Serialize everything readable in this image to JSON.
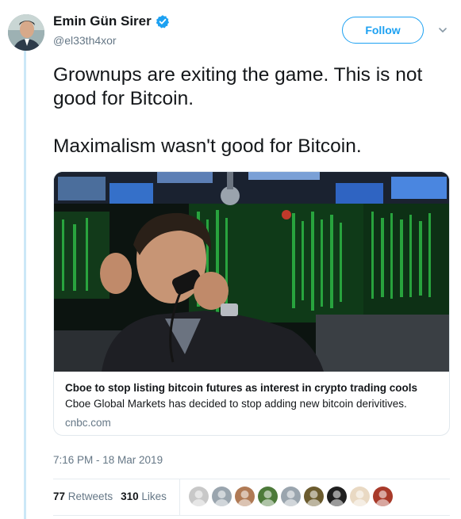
{
  "author": {
    "display_name": "Emin Gün Sirer",
    "handle": "@el33th4xor",
    "verified": true,
    "avatar_icon": "person-avatar"
  },
  "follow_label": "Follow",
  "menu_icon": "chevron-down-icon",
  "tweet": {
    "paragraphs": [
      "Grownups are exiting the game. This is not good for Bitcoin.",
      "Maximalism wasn't good for Bitcoin."
    ]
  },
  "card": {
    "image_icon": "trader-on-phone-photo",
    "title": "Cboe to stop listing bitcoin futures as interest in crypto trading cools",
    "description": "Cboe Global Markets has decided to stop adding new bitcoin derivitives.",
    "domain": "cnbc.com"
  },
  "timestamp": "7:16 PM - 18 Mar 2019",
  "stats": {
    "retweets_count": "77",
    "retweets_label": "Retweets",
    "likes_count": "310",
    "likes_label": "Likes"
  },
  "likers": [
    {
      "icon": "liker-avatar-1",
      "color": "#c8c8c8"
    },
    {
      "icon": "liker-avatar-default",
      "color": "#9aa5ae"
    },
    {
      "icon": "liker-avatar-3",
      "color": "#b07a55"
    },
    {
      "icon": "liker-avatar-4",
      "color": "#4d7a3a"
    },
    {
      "icon": "liker-avatar-default",
      "color": "#9aa5ae"
    },
    {
      "icon": "liker-avatar-6",
      "color": "#6b5b2e"
    },
    {
      "icon": "liker-avatar-hodl",
      "color": "#1f1f1f"
    },
    {
      "icon": "liker-avatar-8",
      "color": "#e9d9c3"
    },
    {
      "icon": "liker-avatar-9",
      "color": "#a83a2a"
    }
  ],
  "colors": {
    "accent": "#1da1f2",
    "text": "#14171a",
    "secondary": "#657786",
    "border": "#e1e8ed",
    "thread_line": "#cce8f7"
  }
}
